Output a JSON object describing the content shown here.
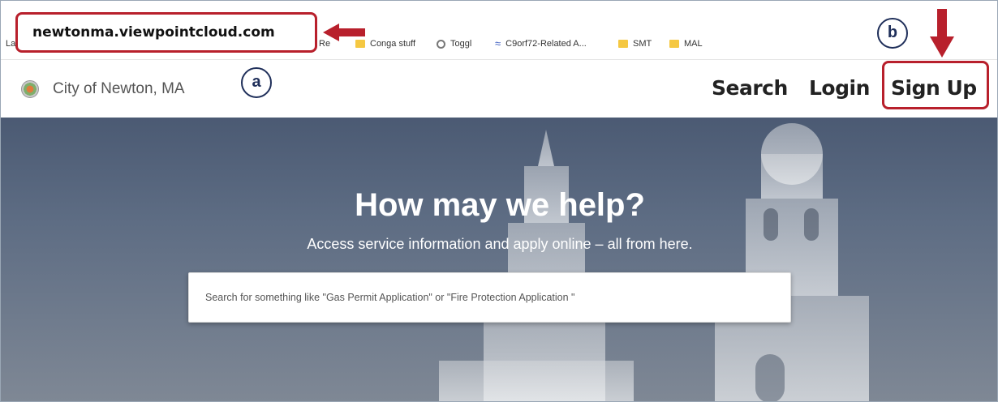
{
  "browser": {
    "url": "newtonma.viewpointcloud.com",
    "bookmarks": [
      {
        "label": "La",
        "icon": "none"
      },
      {
        "label": "Re",
        "icon": "none"
      },
      {
        "label": "Conga stuff",
        "icon": "folder-icon"
      },
      {
        "label": "Toggl",
        "icon": "toggl-icon"
      },
      {
        "label": "C9orf72-Related A...",
        "icon": "link-icon"
      },
      {
        "label": "SMT",
        "icon": "folder-icon"
      },
      {
        "label": "MAL",
        "icon": "folder-icon"
      }
    ]
  },
  "header": {
    "site_name": "City of Newton, MA",
    "nav": {
      "search": "Search",
      "login": "Login",
      "signup": "Sign Up"
    }
  },
  "hero": {
    "title": "How may we help?",
    "subtitle": "Access service information and apply online – all from here.",
    "search_placeholder": "Search for something like \"Gas Permit Application\" or \"Fire Protection Application \""
  },
  "annotations": {
    "marker_a": "a",
    "marker_b": "b",
    "highlight_color": "#b8202c",
    "marker_color": "#1f2f5a"
  }
}
